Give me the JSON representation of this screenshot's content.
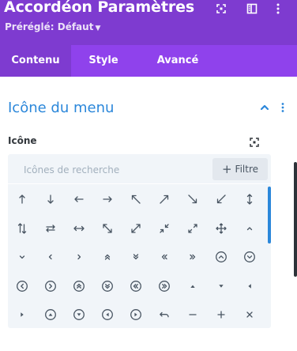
{
  "header": {
    "title": "Accordéon Paramètres",
    "preset": "Préréglé: Défaut",
    "actions": [
      "expand-icon",
      "sidebar-layout-icon",
      "more-vertical-icon"
    ]
  },
  "tabs": [
    {
      "label": "Contenu",
      "active": true
    },
    {
      "label": "Style",
      "active": false
    },
    {
      "label": "Avancé",
      "active": false
    }
  ],
  "section": {
    "title": "Icône du menu",
    "expanded": true
  },
  "icon_field": {
    "label": "Icône"
  },
  "icon_picker": {
    "search_placeholder": "Icônes de recherche",
    "filter_label": "Filtre",
    "icons": [
      "arrow-up",
      "arrow-down",
      "arrow-left",
      "arrow-right",
      "arrow-up-left",
      "arrow-up-right",
      "arrow-down-right",
      "arrow-down-left",
      "arrow-up-down",
      "arrows-up-down",
      "arrows-left-right",
      "arrow-left-right",
      "arrow-down-right-diag",
      "arrow-expand",
      "arrow-compress",
      "arrow-expand-alt",
      "arrow-move",
      "chevron-up",
      "chevron-down",
      "chevron-left",
      "chevron-right",
      "double-chevron-up",
      "double-chevron-down",
      "double-chevron-left",
      "double-chevron-right",
      "circle-chevron-up",
      "circle-chevron-down",
      "circle-chevron-left",
      "circle-chevron-right",
      "circle-double-chevron-up",
      "circle-double-chevron-down",
      "circle-double-chevron-left",
      "circle-double-chevron-right",
      "triangle-up",
      "triangle-down",
      "triangle-left",
      "triangle-right",
      "circle-triangle-up",
      "circle-triangle-down",
      "circle-triangle-left",
      "circle-triangle-right",
      "undo-arrow",
      "minus",
      "plus",
      "close"
    ]
  },
  "colors": {
    "header_bg": "#7e3bd0",
    "tabs_bg": "#8f42ec",
    "accent": "#2b87da",
    "picker_bg": "#f1f5f9"
  }
}
